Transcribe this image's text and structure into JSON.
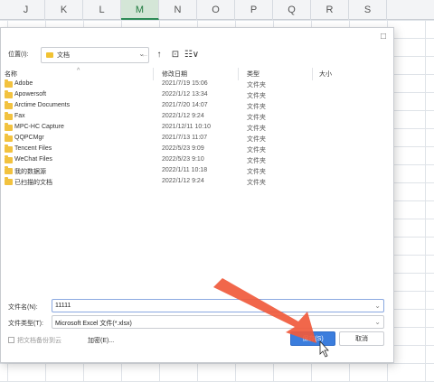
{
  "spreadsheet": {
    "columns": [
      "J",
      "K",
      "L",
      "M",
      "N",
      "O",
      "P",
      "Q",
      "R",
      "S"
    ],
    "selected_column": "M"
  },
  "dialog": {
    "close_label": "□",
    "location_label": "位置(I):",
    "location_value": "文档",
    "nav": {
      "back": "←",
      "forward": "→",
      "up": "↑",
      "new_folder": "⊡",
      "view": "☷∨"
    },
    "columns": {
      "name": "名称",
      "date": "修改日期",
      "type": "类型",
      "size": "大小"
    },
    "files": [
      {
        "name": "Adobe",
        "date": "2021/7/19 15:06",
        "type": "文件夹"
      },
      {
        "name": "Apowersoft",
        "date": "2022/1/12 13:34",
        "type": "文件夹"
      },
      {
        "name": "Arctime Documents",
        "date": "2021/7/20 14:07",
        "type": "文件夹"
      },
      {
        "name": "Fax",
        "date": "2022/1/12 9:24",
        "type": "文件夹"
      },
      {
        "name": "MPC-HC Capture",
        "date": "2021/12/11 10:10",
        "type": "文件夹"
      },
      {
        "name": "QQPCMgr",
        "date": "2021/7/13 11:07",
        "type": "文件夹"
      },
      {
        "name": "Tencent Files",
        "date": "2022/5/23 9:09",
        "type": "文件夹"
      },
      {
        "name": "WeChat Files",
        "date": "2022/5/23 9:10",
        "type": "文件夹"
      },
      {
        "name": "我的数据源",
        "date": "2022/1/11 10:18",
        "type": "文件夹"
      },
      {
        "name": "已扫描的文档",
        "date": "2022/1/12 9:24",
        "type": "文件夹"
      }
    ],
    "filename_label": "文件名(N):",
    "filename_value": "11111",
    "filetype_label": "文件类型(T):",
    "filetype_value": "Microsoft Excel 文件(*.xlsx)",
    "backup_label": "把文档备份到云",
    "encrypt_label": "加密(E)...",
    "save_label": "保存(S)",
    "cancel_label": "取消"
  },
  "colors": {
    "accent": "#3b7ddd",
    "folder": "#f2c23f",
    "annotation_arrow": "#f05a3c"
  }
}
